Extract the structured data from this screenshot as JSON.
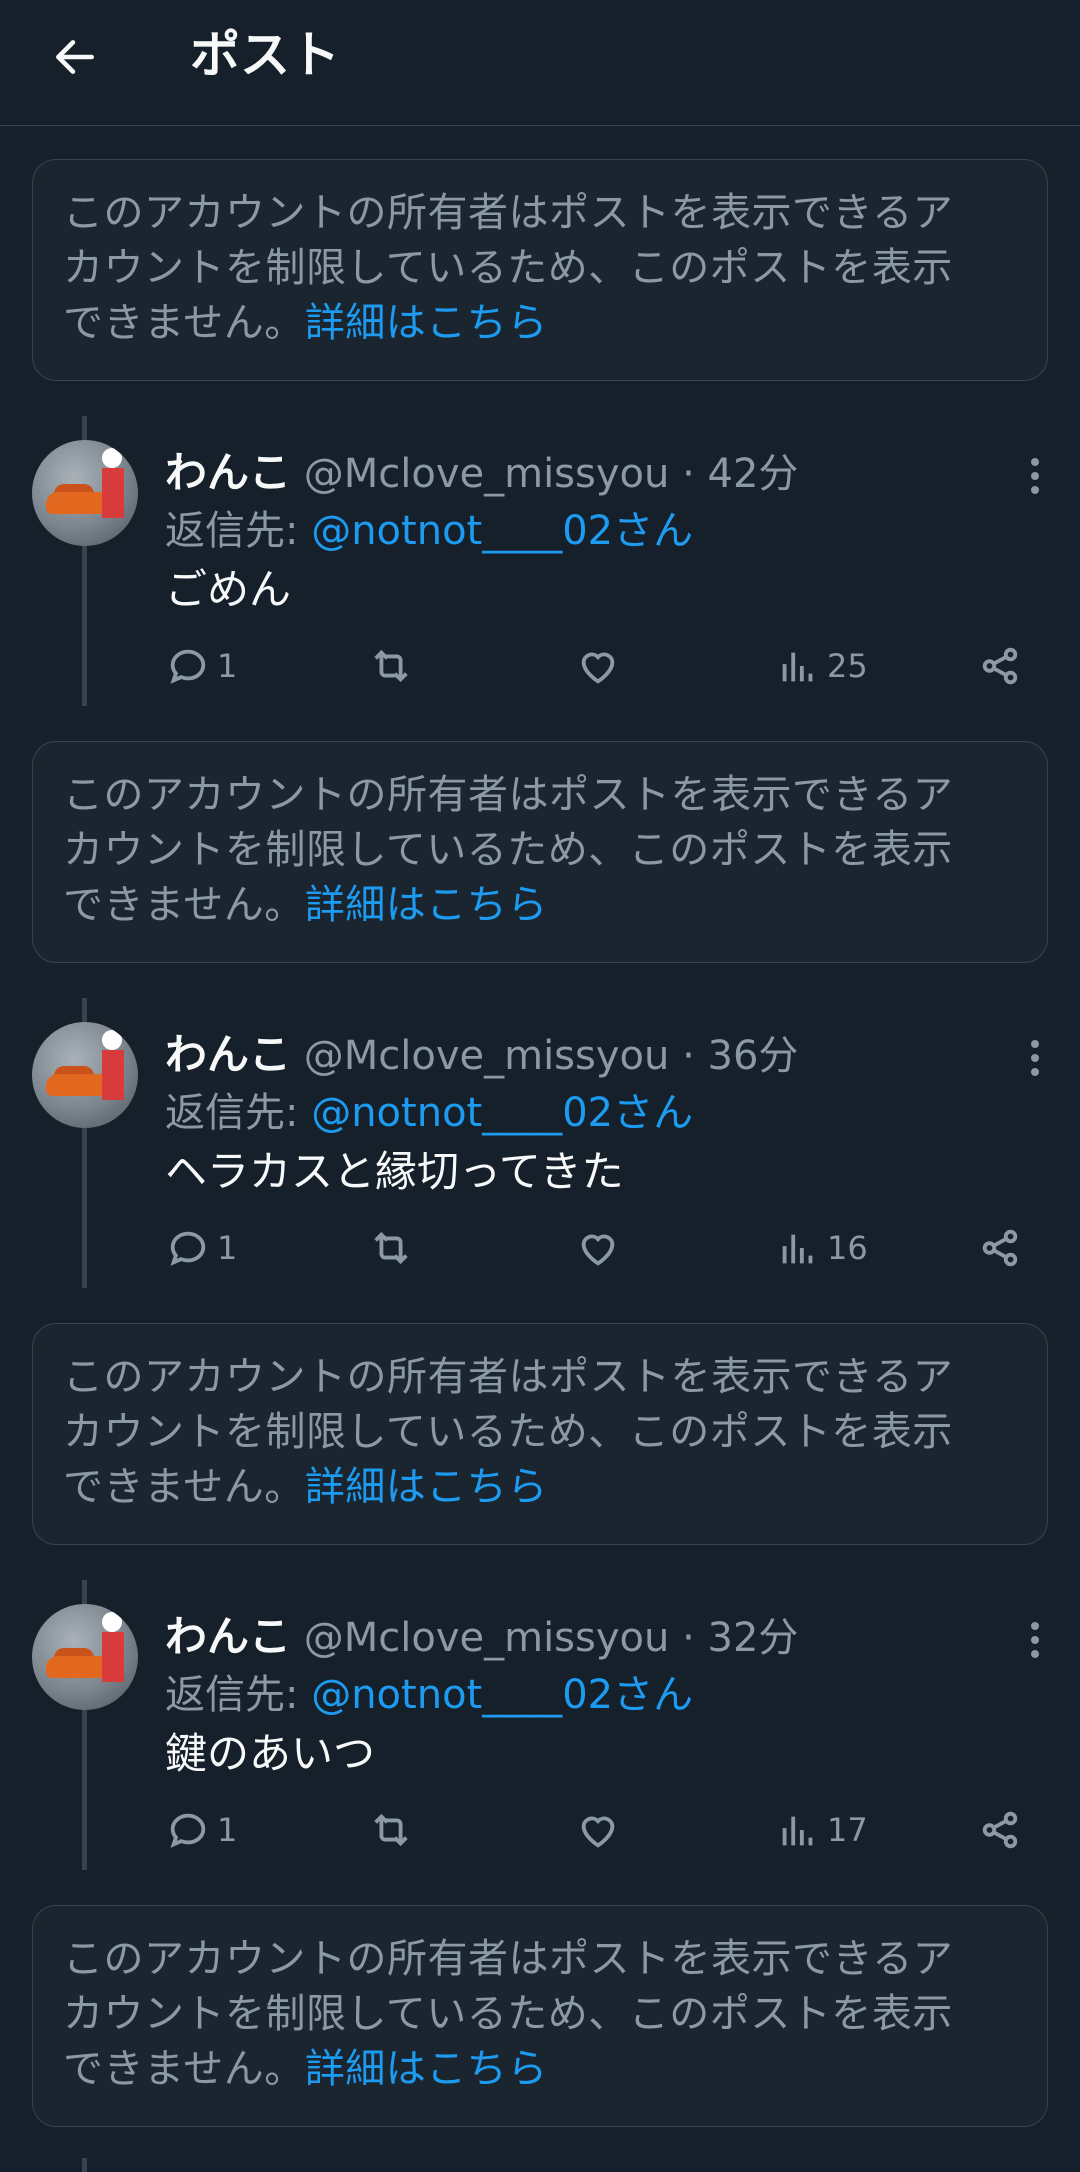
{
  "header": {
    "title": "ポスト",
    "back_icon": "arrow-left-icon"
  },
  "notice": {
    "text": "このアカウントの所有者はポストを表示できるアカウントを制限しているため、このポストを表示できません。",
    "line1": "このアカウントの所有者はポストを表示できるア",
    "line2": "カウントを制限しているため、このポストを表示",
    "line3": "できません。",
    "link": "詳細はこちら"
  },
  "tweets": [
    {
      "author": "わんこ",
      "handle": "@Mclove_missyou",
      "separator": "·",
      "time": "42分",
      "reply_prefix": "返信先: ",
      "reply_mention": "@notnot____02さん",
      "text": "ごめん",
      "replies": "1",
      "views": "25"
    },
    {
      "author": "わんこ",
      "handle": "@Mclove_missyou",
      "separator": "·",
      "time": "36分",
      "reply_prefix": "返信先: ",
      "reply_mention": "@notnot____02さん",
      "text": "ヘラカスと縁切ってきた",
      "replies": "1",
      "views": "16"
    },
    {
      "author": "わんこ",
      "handle": "@Mclove_missyou",
      "separator": "·",
      "time": "32分",
      "reply_prefix": "返信先: ",
      "reply_mention": "@notnot____02さん",
      "text": "鍵のあいつ",
      "replies": "1",
      "views": "17"
    }
  ],
  "colors": {
    "background": "#15202b",
    "accent": "#1d9bf0",
    "muted": "#8b98a5",
    "border": "#38444d"
  },
  "icons": {
    "reply": "reply-icon",
    "retweet": "retweet-icon",
    "like": "heart-icon",
    "views": "views-icon",
    "share": "share-icon",
    "more": "more-vertical-icon"
  }
}
